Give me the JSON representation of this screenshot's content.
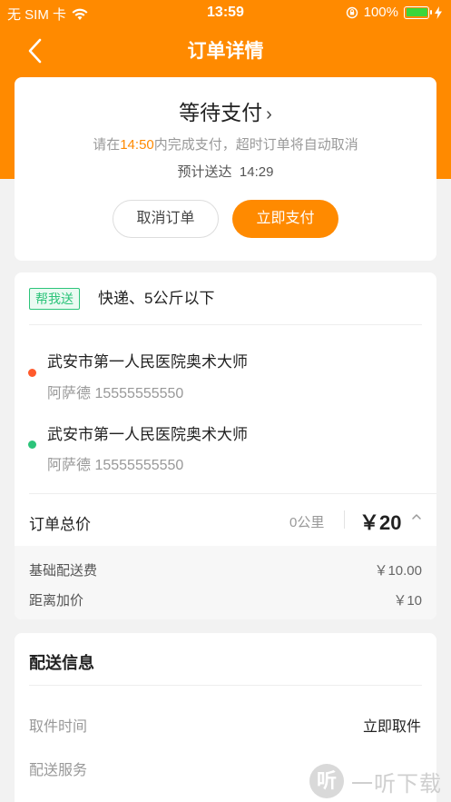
{
  "status_bar": {
    "carrier": "无 SIM 卡",
    "time": "13:59",
    "battery_percent": "100%",
    "battery_level": 1.0
  },
  "nav": {
    "title": "订单详情"
  },
  "order_status": {
    "title": "等待支付",
    "hint_prefix": "请在",
    "deadline": "14:50",
    "hint_suffix": "内完成支付，超时订单将自动取消",
    "eta_label": "预计送达",
    "eta_time": "14:29",
    "cancel_label": "取消订单",
    "pay_label": "立即支付"
  },
  "delivery": {
    "tag": "帮我送",
    "description": "快递、5公斤以下",
    "pickup": {
      "name": "武安市第一人民医院奥术大师",
      "contact": "阿萨德 15555555550",
      "dot_color": "#ff5a2c"
    },
    "dropoff": {
      "name": "武安市第一人民医院奥术大师",
      "contact": "阿萨德 15555555550",
      "dot_color": "#2cc47a"
    }
  },
  "price": {
    "total_label": "订单总价",
    "distance": "0公里",
    "total": "￥20",
    "fees": [
      {
        "label": "基础配送费",
        "value": "￥10.00"
      },
      {
        "label": "距离加价",
        "value": "￥10"
      }
    ]
  },
  "delivery_info": {
    "title": "配送信息",
    "rows": [
      {
        "label": "取件时间",
        "value": "立即取件"
      },
      {
        "label": "配送服务",
        "value": ""
      }
    ]
  },
  "watermark": {
    "text": "一听下载",
    "logo_char": "听"
  },
  "colors": {
    "accent": "#ff8a00",
    "tag_green": "#2cc47a",
    "pickup_red": "#ff5a2c"
  }
}
